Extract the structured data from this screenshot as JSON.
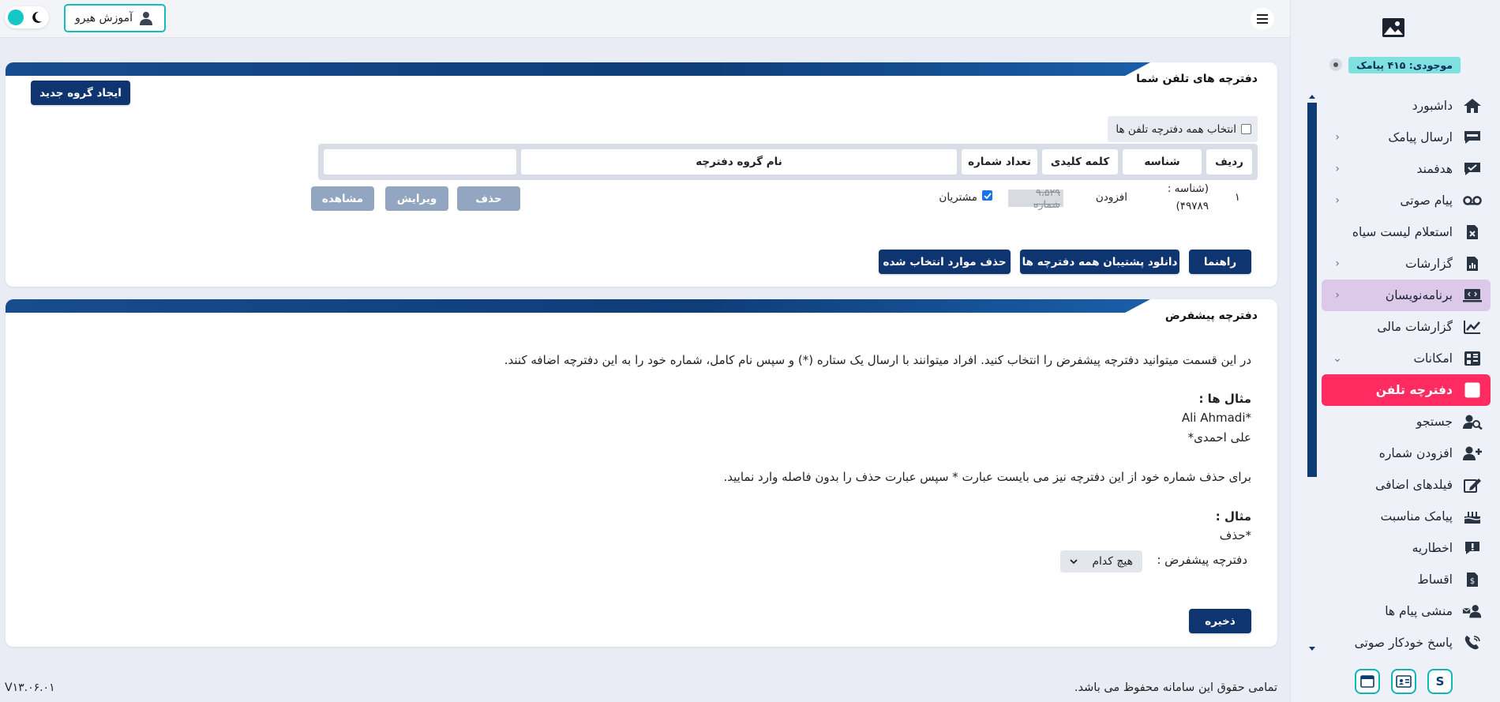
{
  "header": {
    "user_label": "آموزش هیرو",
    "version": "V۱۳.۰۶.۰۱"
  },
  "sidebar": {
    "balance_label": "موجودی: ۴۱۵ پیامک",
    "items": [
      {
        "label": "داشبورد",
        "icon": "home-icon",
        "chevron": ""
      },
      {
        "label": "ارسال پیامک",
        "icon": "sms-icon",
        "chevron": "‹"
      },
      {
        "label": "هدفمند",
        "icon": "target-message-icon",
        "chevron": "‹"
      },
      {
        "label": "پیام صوتی",
        "icon": "voicemail-icon",
        "chevron": "‹"
      },
      {
        "label": "استعلام لیست سیاه",
        "icon": "blacklist-icon",
        "chevron": ""
      },
      {
        "label": "گزارشات",
        "icon": "report-icon",
        "chevron": "‹"
      },
      {
        "label": "برنامه‌نویسان",
        "icon": "developers-icon",
        "chevron": "‹"
      },
      {
        "label": "گزارشات مالی",
        "icon": "financial-chart-icon",
        "chevron": ""
      },
      {
        "label": "امکانات",
        "icon": "features-icon",
        "chevron": "⌄"
      },
      {
        "label": "دفترچه تلفن",
        "icon": "phonebook-icon",
        "chevron": ""
      },
      {
        "label": "جستجو",
        "icon": "user-search-icon",
        "chevron": ""
      },
      {
        "label": "افزودن شماره",
        "icon": "add-user-icon",
        "chevron": ""
      },
      {
        "label": "فیلدهای اضافی",
        "icon": "edit-icon",
        "chevron": ""
      },
      {
        "label": "پیامک مناسبت",
        "icon": "cake-icon",
        "chevron": ""
      },
      {
        "label": "اخطاریه",
        "icon": "alert-icon",
        "chevron": ""
      },
      {
        "label": "اقساط",
        "icon": "installment-icon",
        "chevron": ""
      },
      {
        "label": "منشی پیام ها",
        "icon": "secretary-icon",
        "chevron": ""
      },
      {
        "label": "پاسخ خودکار صوتی",
        "icon": "phone-reply-icon",
        "chevron": ""
      }
    ]
  },
  "phonebooks": {
    "title": "دفترچه های تلفن شما",
    "create_group": "ایجاد گروه جدید",
    "select_all": "انتخاب همه دفترچه تلفن ها",
    "columns": {
      "row": "ردیف",
      "id": "شناسه",
      "keyword": "کلمه کلیدی",
      "count": "تعداد شماره",
      "name": "نام گروه دفترچه"
    },
    "row": {
      "index": "۱",
      "id_line1": "(شناسه :",
      "id_line2": "۴۹۷۸۹)",
      "keyword": "افزودن",
      "count": "۹،۵۲۹ شماره",
      "name": "مشتریان",
      "delete": "حذف",
      "edit": "ویرایش",
      "view": "مشاهده"
    },
    "actions": {
      "help": "راهنما",
      "download_backup": "دانلود پشتیبان همه دفترچه ها",
      "delete_selected": "حذف موارد انتخاب شده"
    }
  },
  "default_book": {
    "title": "دفترچه پیشفرض",
    "intro": "در این قسمت میتوانید دفترچه پیشفرض را انتخاب کنید. افراد میتوانند با ارسال یک ستاره (*) و سپس نام کامل، شماره خود را به این دفترچه اضافه کنند.",
    "examples_title": "مثال ها :",
    "example1": "*Ali Ahmadi",
    "example2": "علی احمدی*",
    "remove_text": "برای حذف شماره خود از این دفترچه نیز می بایست عبارت * سپس عبارت حذف را بدون فاصله وارد نمایید.",
    "example_title": "مثال :",
    "example3": "*حذف",
    "select_label": "دفترچه پیشفرض :",
    "select_value": "هیچ کدام",
    "save": "ذخیره"
  },
  "footer": {
    "copyright": "تمامی حقوق این سامانه محفوظ می باشد."
  }
}
